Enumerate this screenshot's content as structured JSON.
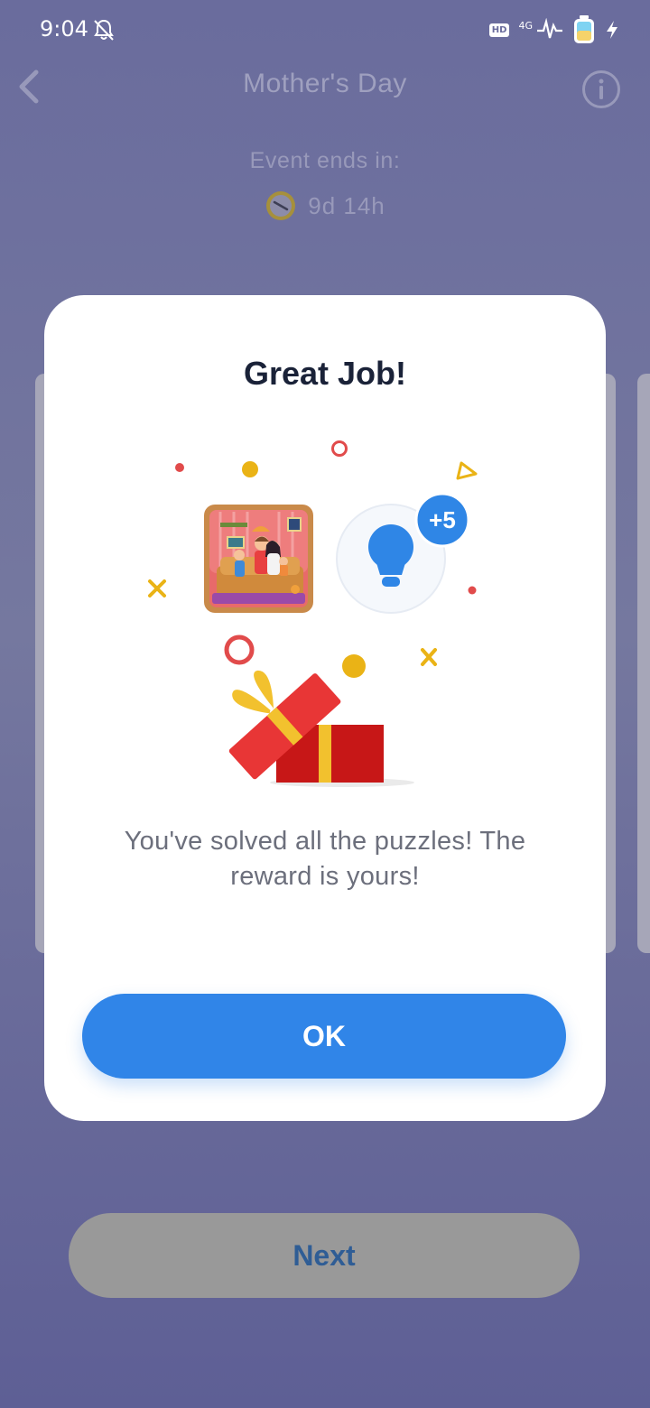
{
  "status_bar": {
    "time": "9:04",
    "icons": [
      "bell-off-icon",
      "hd-icon",
      "signal-icon",
      "battery-icon",
      "charging-icon"
    ],
    "hd_label": "HD",
    "network_label": "4G"
  },
  "header": {
    "title": "Mother's Day",
    "back_icon": "chevron-left-icon",
    "info_icon": "info-icon"
  },
  "event": {
    "label": "Event ends in:",
    "time_left": "9d 14h",
    "icon": "clock-icon"
  },
  "dialog": {
    "title": "Great Job!",
    "reward_badge": "+5",
    "reward_icon": "lightbulb-icon",
    "puzzle_image": "family-puzzle-thumbnail",
    "gift_icon": "gift-box-icon",
    "message": "You've solved all the puzzles! The reward is yours!",
    "ok_label": "OK"
  },
  "footer": {
    "next_label": "Next"
  },
  "colors": {
    "background": "#6a6c9d",
    "dialog_bg": "#ffffff",
    "primary_button": "#3085e8",
    "title_text": "#1a2238",
    "next_button_bg": "#999999",
    "next_button_text": "#2f5d95"
  }
}
